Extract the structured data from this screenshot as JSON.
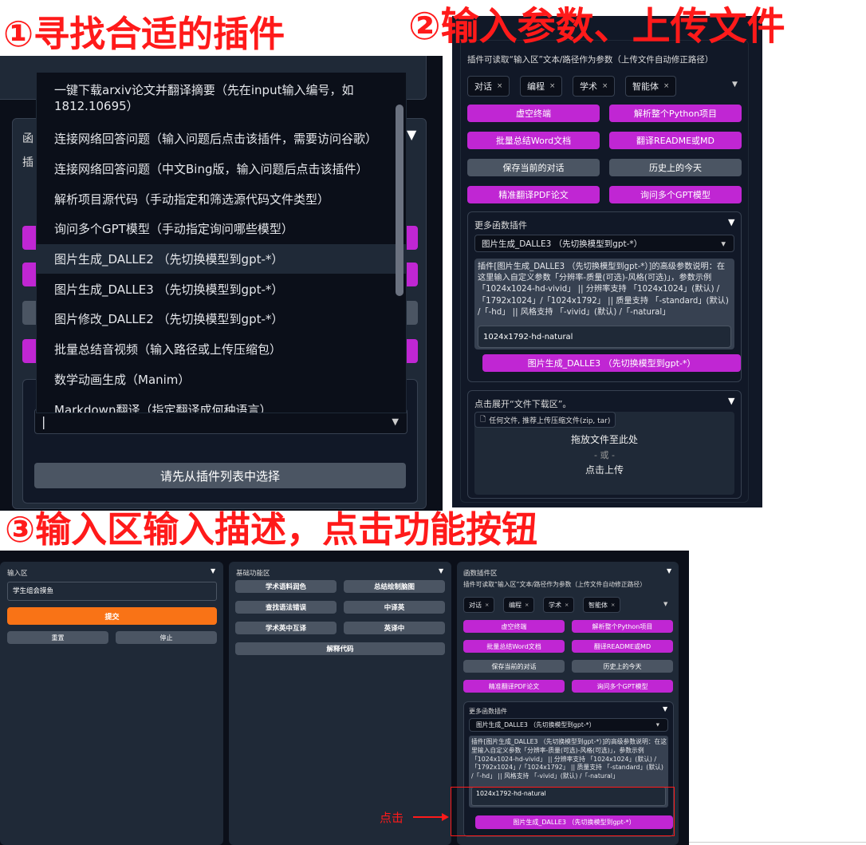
{
  "headings": {
    "step1": "①寻找合适的插件",
    "step2": "②输入参数、上传文件",
    "step3": "③输入区输入描述，点击功能按钮"
  },
  "step1": {
    "panel_title_partial": "函",
    "panel_subtitle_partial": "插",
    "dropdown_items": [
      "一键下载arxiv论文并翻译摘要（先在input输入编号，如1812.10695）",
      "连接网络回答问题（输入问题后点击该插件，需要访问谷歌）",
      "连接网络回答问题（中文Bing版，输入问题后点击该插件）",
      "解析项目源代码（手动指定和筛选源代码文件类型）",
      "询问多个GPT模型（手动指定询问哪些模型）",
      "图片生成_DALLE2 （先切换模型到gpt-*）",
      "图片生成_DALLE3 （先切换模型到gpt-*）",
      "图片修改_DALLE2 （先切换模型到gpt-*）",
      "批量总结音视频（输入路径或上传压缩包）",
      "数学动画生成（Manim）",
      "Markdown翻译（指定翻译成何种语言）"
    ],
    "highlighted_index": 5,
    "empty_select_value": "|",
    "select_first_button": "请先从插件列表中选择"
  },
  "plugin_area": {
    "title": "函数插件区",
    "subtitle": "插件可读取“输入区”文本/路径作为参数（上传文件自动修正路径）",
    "tags": [
      "对话",
      "编程",
      "学术",
      "智能体"
    ],
    "tag_close": "×",
    "buttons": [
      {
        "label": "虚空终端",
        "color": "purple"
      },
      {
        "label": "解析整个Python项目",
        "color": "purple"
      },
      {
        "label": "批量总结Word文档",
        "color": "purple"
      },
      {
        "label": "翻译README或MD",
        "color": "purple"
      },
      {
        "label": "保存当前的对话",
        "color": "gray"
      },
      {
        "label": "历史上的今天",
        "color": "gray"
      },
      {
        "label": "精准翻译PDF论文",
        "color": "purple"
      },
      {
        "label": "询问多个GPT模型",
        "color": "purple"
      }
    ],
    "more_title": "更多函数插件",
    "more_select": "图片生成_DALLE3 （先切换模型到gpt-*）",
    "advanced_desc": "插件[图片生成_DALLE3 （先切换模型到gpt-*）]的高级参数说明：在这里输入自定义参数「分辨率-质量(可选)-风格(可选)」，参数示例「1024x1024-hd-vivid」 || 分辨率支持 「1024x1024」(默认) /「1792x1024」/「1024x1792」 || 质量支持 「-standard」(默认) /「-hd」 || 风格支持 「-vivid」(默认) /「-natural」",
    "advanced_value": "1024x1792-hd-natural",
    "run_button": "图片生成_DALLE3 （先切换模型到gpt-*）",
    "upload_title": "点击展开“文件下载区”。",
    "upload_chip": "任何文件, 推荐上传压缩文件(zip, tar)",
    "drop_text": "拖放文件至此处",
    "or_text": "- 或 -",
    "click_upload": "点击上传"
  },
  "step3": {
    "input_title": "输入区",
    "input_value": "学生组会摸鱼",
    "submit": "提交",
    "reset": "重置",
    "stop": "停止",
    "basic_title": "基础功能区",
    "basic_buttons": [
      "学术语料润色",
      "总结绘制脑图",
      "查找语法错误",
      "中译英",
      "学术英中互译",
      "英译中",
      "解释代码"
    ],
    "click_label": "点击"
  },
  "colors": {
    "annotation_red": "#ff1a1a",
    "purple": "#c026d3",
    "orange": "#f97316",
    "gray": "#4b5563",
    "panel_bg": "#0b0f19"
  }
}
